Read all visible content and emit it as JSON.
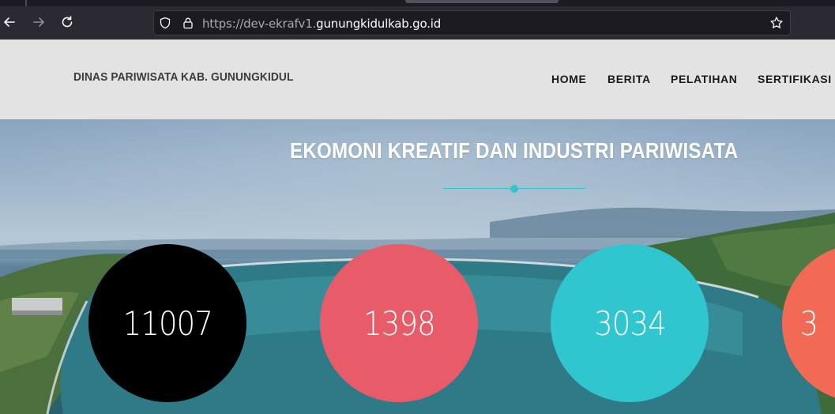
{
  "browser": {
    "url_prefix": "https://dev-ekrafv1.",
    "url_domain": "gunungkidulkab.go.id",
    "back_icon": "arrow-left-icon",
    "forward_icon": "arrow-right-icon",
    "reload_icon": "reload-icon",
    "shield_icon": "shield-icon",
    "lock_icon": "lock-icon",
    "bookmark_icon": "star-icon"
  },
  "header": {
    "brand": "DINAS PARIWISATA KAB. GUNUNGKIDUL",
    "nav": [
      "HOME",
      "BERITA",
      "PELATIHAN",
      "SERTIFIKASI"
    ]
  },
  "hero": {
    "title": "EKOMONI KREATIF DAN INDUSTRI PARIWISATA",
    "accent_color": "#33c3cf",
    "stats": [
      {
        "value": "11007",
        "color": "#000000"
      },
      {
        "value": "1398",
        "color": "#e85c6a"
      },
      {
        "value": "3034",
        "color": "#30c6cf"
      },
      {
        "value": "3",
        "color": "#f26a55"
      }
    ]
  }
}
